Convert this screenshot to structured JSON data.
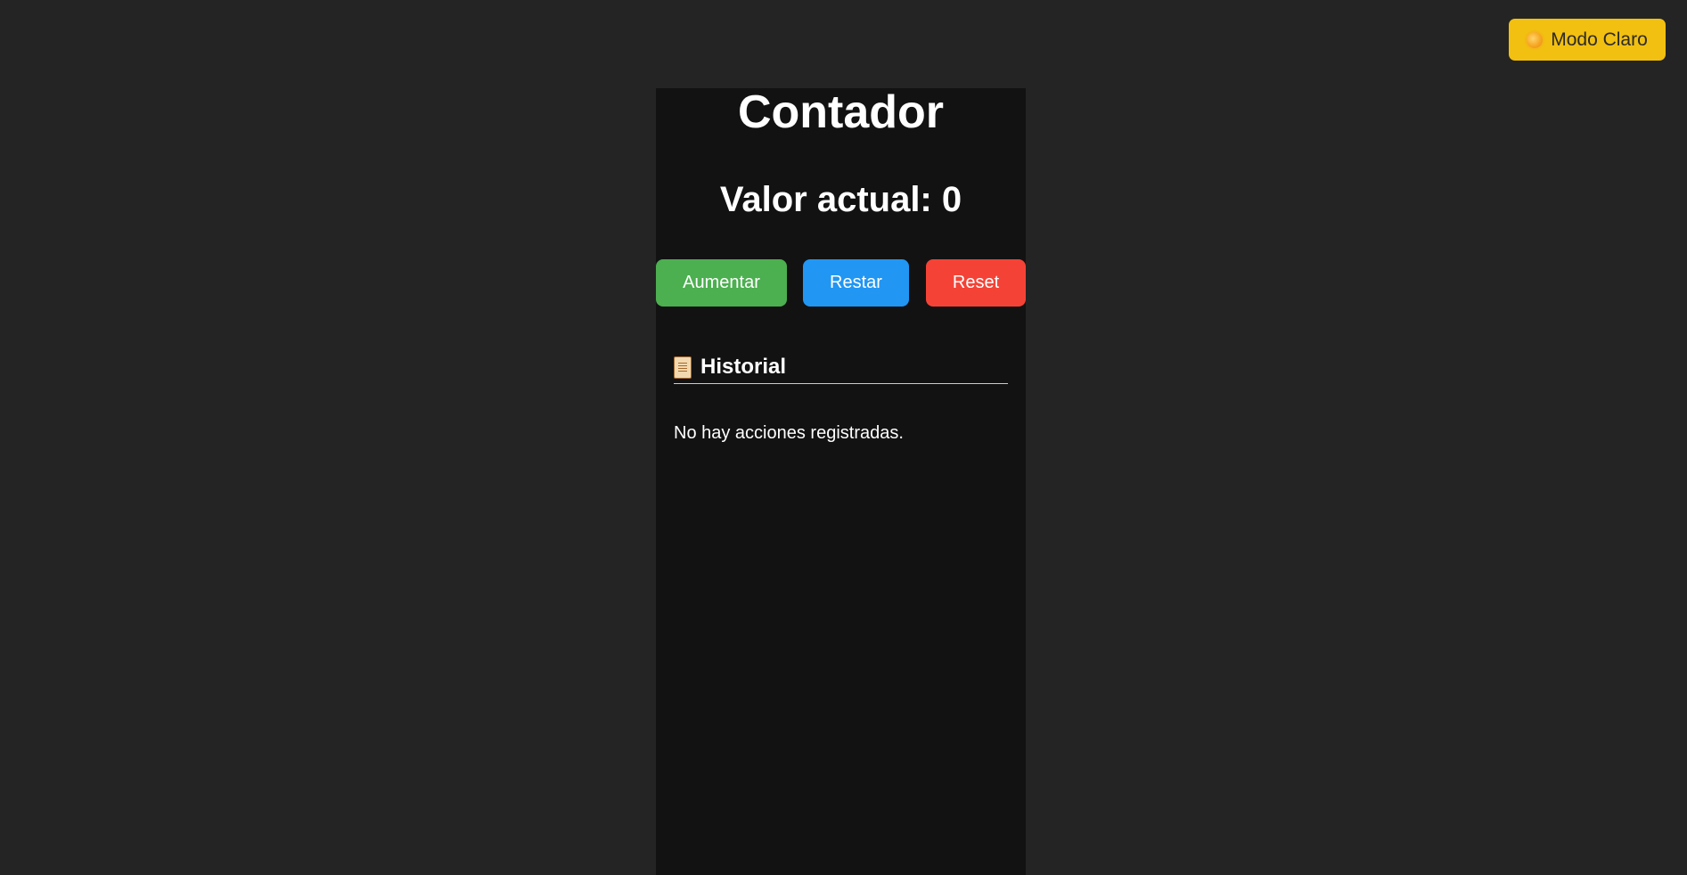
{
  "theme_toggle": {
    "icon": "sun-icon",
    "label": "Modo Claro"
  },
  "counter": {
    "title": "Contador",
    "value_text": "Valor actual: 0"
  },
  "buttons": {
    "increment": "Aumentar",
    "decrement": "Restar",
    "reset": "Reset"
  },
  "history": {
    "icon": "scroll-icon",
    "title": "Historial",
    "empty_text": "No hay acciones registradas."
  },
  "colors": {
    "background": "#242424",
    "panel": "#121212",
    "toggle": "#f2c010",
    "increment": "#4caf50",
    "decrement": "#2196f3",
    "reset": "#f44336"
  }
}
